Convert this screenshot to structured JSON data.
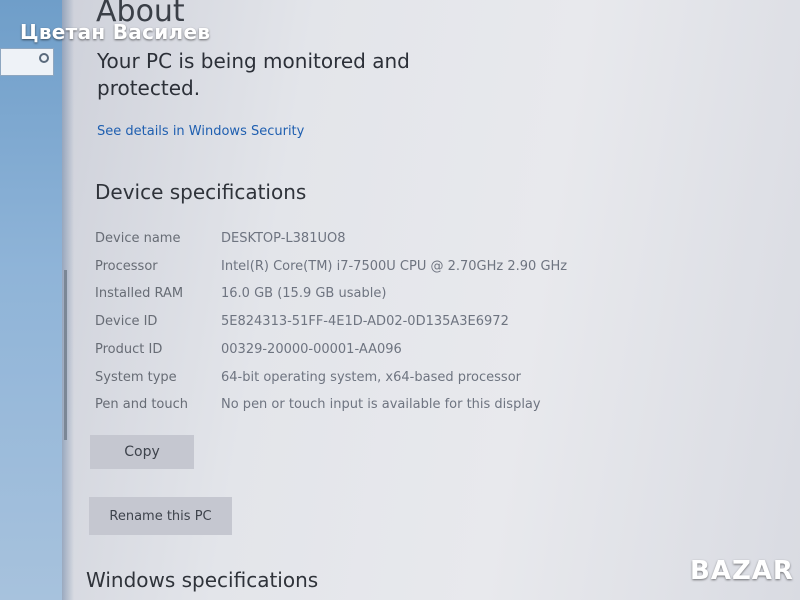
{
  "watermark_text": "Цветан Василев",
  "page_title": "About",
  "security": {
    "status_text": "Your PC is being monitored and protected.",
    "link_text": "See details in Windows Security"
  },
  "device_specs": {
    "title": "Device specifications",
    "rows": [
      {
        "label": "Device name",
        "value": "DESKTOP-L381UO8"
      },
      {
        "label": "Processor",
        "value": "Intel(R) Core(TM) i7-7500U CPU @ 2.70GHz   2.90 GHz"
      },
      {
        "label": "Installed RAM",
        "value": "16.0 GB (15.9 GB usable)"
      },
      {
        "label": "Device ID",
        "value": "5E824313-51FF-4E1D-AD02-0D135A3E6972"
      },
      {
        "label": "Product ID",
        "value": "00329-20000-00001-AA096"
      },
      {
        "label": "System type",
        "value": "64-bit operating system, x64-based processor"
      },
      {
        "label": "Pen and touch",
        "value": "No pen or touch input is available for this display"
      }
    ],
    "copy_label": "Copy",
    "rename_label": "Rename this PC"
  },
  "windows_specs": {
    "title": "Windows specifications"
  },
  "brand_logo": "BAZAR",
  "icons": {
    "search": "search-icon"
  },
  "colors": {
    "link": "#1f5fb0",
    "sidebar": "#7ea6cf",
    "button": "#c5c7d0"
  }
}
